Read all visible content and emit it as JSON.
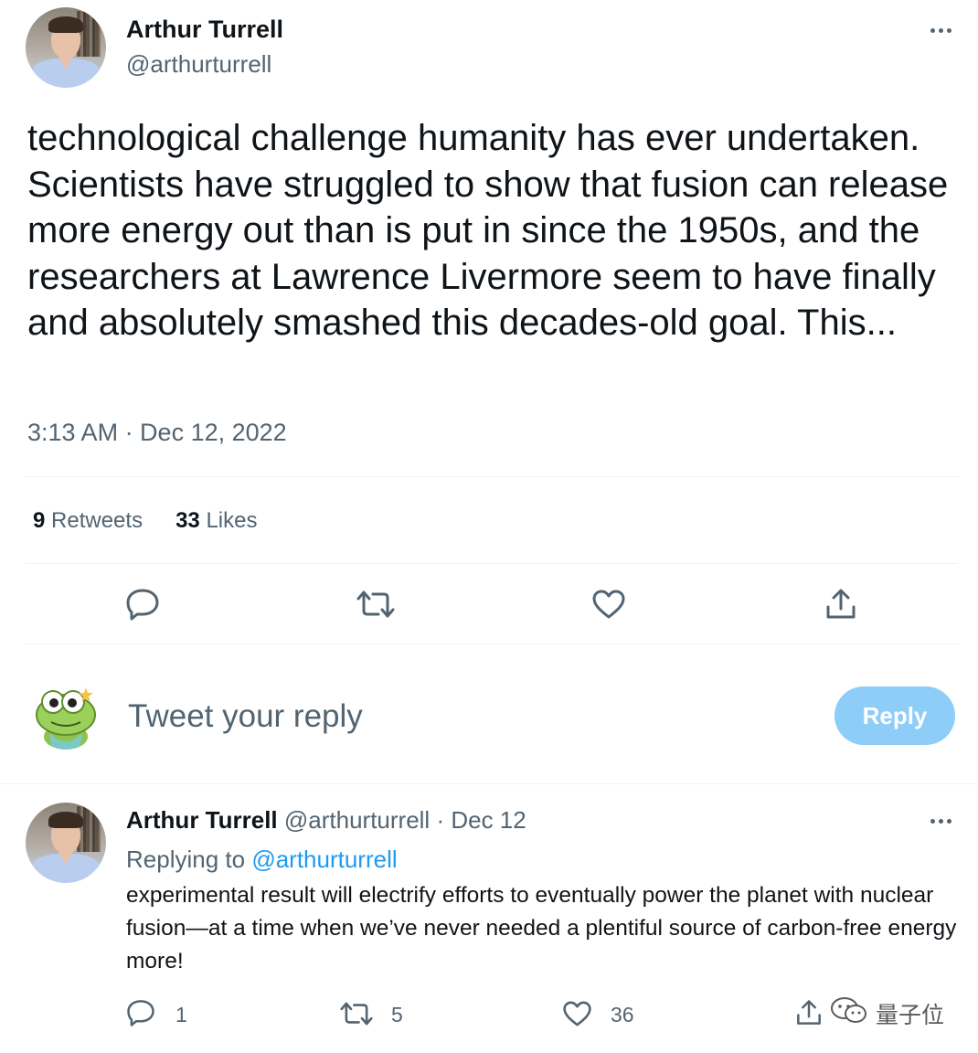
{
  "main_tweet": {
    "author_name": "Arthur Turrell",
    "author_handle": "@arthurturrell",
    "text": "technological challenge humanity has ever undertaken. Scientists have struggled to show that fusion can release more energy out than is put in since the 1950s, and the researchers at Lawrence Livermore seem to have finally and absolutely smashed this decades-old goal. This...",
    "timestamp": "3:13 AM · Dec 12, 2022",
    "retweets_count": "9",
    "retweets_label": "Retweets",
    "likes_count": "33",
    "likes_label": "Likes",
    "actions": [
      "reply-icon",
      "retweet-icon",
      "like-icon",
      "share-icon"
    ]
  },
  "composer": {
    "placeholder": "Tweet your reply",
    "reply_button": "Reply",
    "reply_button_color": "#8ecdf8"
  },
  "reply_tweet": {
    "author_name": "Arthur Turrell",
    "author_handle": "@arthurturrell",
    "dot": "·",
    "date": "Dec 12",
    "replying_label": "Replying to",
    "replying_to": "@arthurturrell",
    "text": "experimental result will electrify efforts to eventually power the planet with nuclear fusion—at a time when we’ve never needed a plentiful source of carbon-free energy more!",
    "reply_count": "1",
    "retweet_count": "5",
    "like_count": "36"
  },
  "watermark": {
    "text": "量子位"
  },
  "colors": {
    "link": "#1d9bf0",
    "muted": "#536471",
    "text": "#0f1419"
  }
}
